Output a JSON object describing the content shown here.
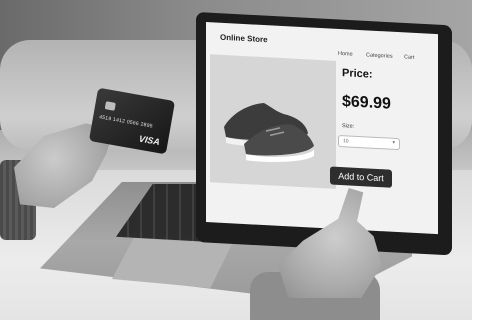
{
  "store": {
    "name": "Online Store",
    "nav": [
      "Home",
      "Categories",
      "Cart"
    ]
  },
  "product": {
    "price_label": "Price:",
    "price": "$69.99",
    "size_label": "Size:",
    "size_value": "10",
    "add_to_cart": "Add to Cart",
    "image_icon": "sneaker-icon"
  },
  "credit_card": {
    "number": "4519 1412 0566 2895",
    "brand": "VISA"
  }
}
